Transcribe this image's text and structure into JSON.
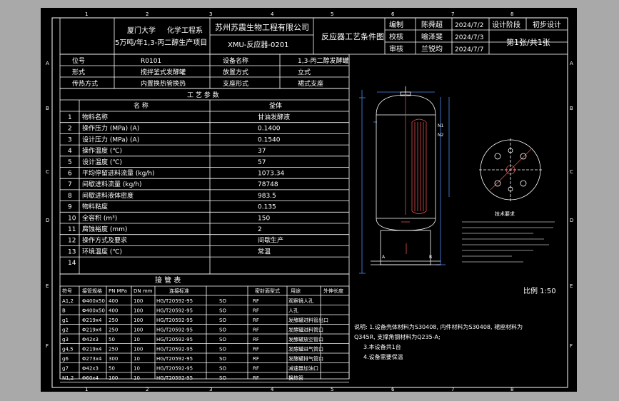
{
  "title_block": {
    "org_left": [
      "厦门大学",
      "化学工程系"
    ],
    "project": "5万吨/年1,3-丙二醇生产项目",
    "company": "苏州苏震生物工程有限公司",
    "drawing_no": "XMU-反应器-0201",
    "drawing_title": "反应器工艺条件图",
    "rows": [
      {
        "role": "编制",
        "name": "陈舜超",
        "date": "2024/7/2"
      },
      {
        "role": "校核",
        "name": "喻泽斐",
        "date": "2024/7/3"
      },
      {
        "role": "审核",
        "name": "兰锐均",
        "date": "2024/7/7"
      }
    ],
    "stage_label": "设计阶段",
    "stage_value": "初步设计",
    "sheet_info": "第1张/共1张"
  },
  "equipment_info": [
    [
      "位号",
      "R0101",
      "设备名称",
      "1,3-丙二醇发酵罐"
    ],
    [
      "形式",
      "搅拌釜式发酵罐",
      "放置方式",
      "立式"
    ],
    [
      "传热方式",
      "内置换热管换热",
      "支座形式",
      "裙式支座"
    ]
  ],
  "process_params": {
    "title": "工 艺 参 数",
    "header": [
      "名 称",
      "釜体"
    ],
    "rows": [
      [
        "1",
        "物料名称",
        "甘油发酵液"
      ],
      [
        "2",
        "操作压力 (MPa) (A)",
        "0.1400"
      ],
      [
        "3",
        "设计压力 (MPa) (A)",
        "0.1540"
      ],
      [
        "4",
        "操作温度 (℃)",
        "37"
      ],
      [
        "5",
        "设计温度 (℃)",
        "57"
      ],
      [
        "6",
        "平均停留进料流量 (kg/h)",
        "1073.34"
      ],
      [
        "7",
        "间歇进料流量 (kg/h)",
        "78748"
      ],
      [
        "8",
        "间歇进料液体密度",
        "983.5"
      ],
      [
        "9",
        "物料粘度",
        "0.135"
      ],
      [
        "10",
        "全容积 (m³)",
        "150"
      ],
      [
        "11",
        "腐蚀裕度 (mm)",
        "2"
      ],
      [
        "12",
        "操作方式及要求",
        "间歇生产"
      ],
      [
        "13",
        "环境温度 (℃)",
        "常温"
      ],
      [
        "14",
        "",
        ""
      ]
    ]
  },
  "nozzle_table": {
    "title": "接 管 表",
    "header": [
      "符号",
      "接管规格",
      "PN MPa",
      "DN mm",
      "连接标准",
      "密封面型式",
      "用途",
      "外伸长度"
    ],
    "rows": [
      [
        "A1,2",
        "Φ400x50",
        "400",
        "100",
        "HG/T20592-95",
        "SO",
        "RF",
        "观察镜人孔"
      ],
      [
        "B",
        "Φ400x50",
        "400",
        "100",
        "HG/T20592-95",
        "SO",
        "RF",
        "人孔"
      ],
      [
        "g1",
        "Φ219x4",
        "250",
        "100",
        "HG/T20592-95",
        "SO",
        "RF",
        "发酵罐进料管出口"
      ],
      [
        "g2",
        "Φ219x4",
        "250",
        "100",
        "HG/T20592-95",
        "SO",
        "RF",
        "发酵罐进料管口"
      ],
      [
        "g3",
        "Φ42x3",
        "50",
        "10",
        "HG/T20592-95",
        "SO",
        "RF",
        "发酵罐放空管口"
      ],
      [
        "g4,5",
        "Φ219x4",
        "250",
        "100",
        "HG/T20592-95",
        "SO",
        "RF",
        "发酵罐进气管口"
      ],
      [
        "g6",
        "Φ273x4",
        "300",
        "10",
        "HG/T20592-95",
        "SO",
        "RF",
        "发酵罐排气管口"
      ],
      [
        "g7",
        "Φ42x3",
        "50",
        "10",
        "HG/T20592-95",
        "SO",
        "RF",
        "减速器加油口"
      ],
      [
        "N1,2",
        "Φ60x4",
        "100",
        "10",
        "HG/T20592-95",
        "SO",
        "RF",
        "换热管"
      ]
    ]
  },
  "notes": [
    "说明: 1.设备壳体材料为S30408, 内件材料为S30408, 裙座材料为",
    "Q345R, 支撑角钢材料为Q235-A;",
    "3.本设备共1台",
    "4.设备需要保温"
  ],
  "tech_req_title": "技术要求",
  "scale": "比例 1:50",
  "row_letters": [
    "A",
    "B",
    "C",
    "D",
    "E",
    "F"
  ],
  "col_numbers": [
    "1",
    "2",
    "3",
    "4",
    "5",
    "6",
    "7",
    "8"
  ],
  "colors": {
    "background": "#000000",
    "frame": "#ffffff",
    "vessel": "#e05050",
    "dimension": "#4a8df6",
    "app_bg": "#a9a9a9"
  }
}
